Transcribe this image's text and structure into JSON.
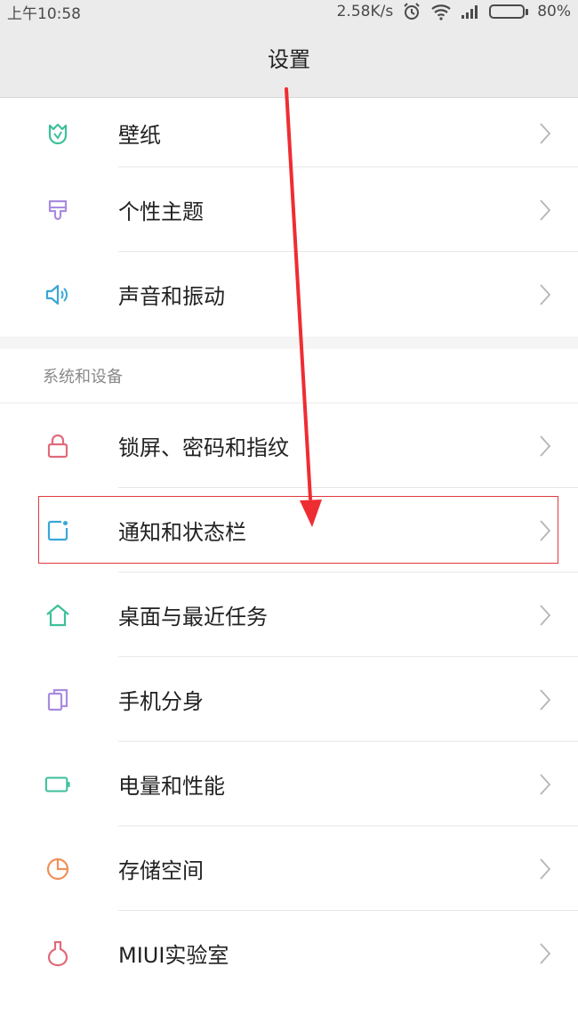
{
  "status_bar": {
    "time": "上午10:58",
    "net_speed": "2.58K/s",
    "battery_percent": "80%",
    "battery_level": 0.8,
    "icons": [
      "alarm-icon",
      "wifi-icon",
      "signal-icon",
      "battery-icon"
    ]
  },
  "header": {
    "title": "设置"
  },
  "group1": {
    "items": [
      {
        "label": "壁纸",
        "icon": "wallpaper-icon",
        "color": "#3dbf9a"
      },
      {
        "label": "个性主题",
        "icon": "theme-icon",
        "color": "#a98be0"
      },
      {
        "label": "声音和振动",
        "icon": "sound-icon",
        "color": "#3aa7d8"
      }
    ]
  },
  "section": {
    "title": "系统和设备"
  },
  "group2": {
    "items": [
      {
        "label": "锁屏、密码和指纹",
        "icon": "lock-icon",
        "color": "#e06a7a"
      },
      {
        "label": "通知和状态栏",
        "icon": "notification-icon",
        "color": "#3aa7d8"
      },
      {
        "label": "桌面与最近任务",
        "icon": "home-icon",
        "color": "#3dbf9a"
      },
      {
        "label": "手机分身",
        "icon": "second-space-icon",
        "color": "#a98be0"
      },
      {
        "label": "电量和性能",
        "icon": "battery-performance-icon",
        "color": "#3dbf9a"
      },
      {
        "label": "存储空间",
        "icon": "storage-icon",
        "color": "#f0905a"
      },
      {
        "label": "MIUI实验室",
        "icon": "lab-flask-icon",
        "color": "#e06a7a"
      }
    ]
  },
  "colors": {
    "highlight": "#e0393e",
    "chevron": "#b5b5b5"
  }
}
